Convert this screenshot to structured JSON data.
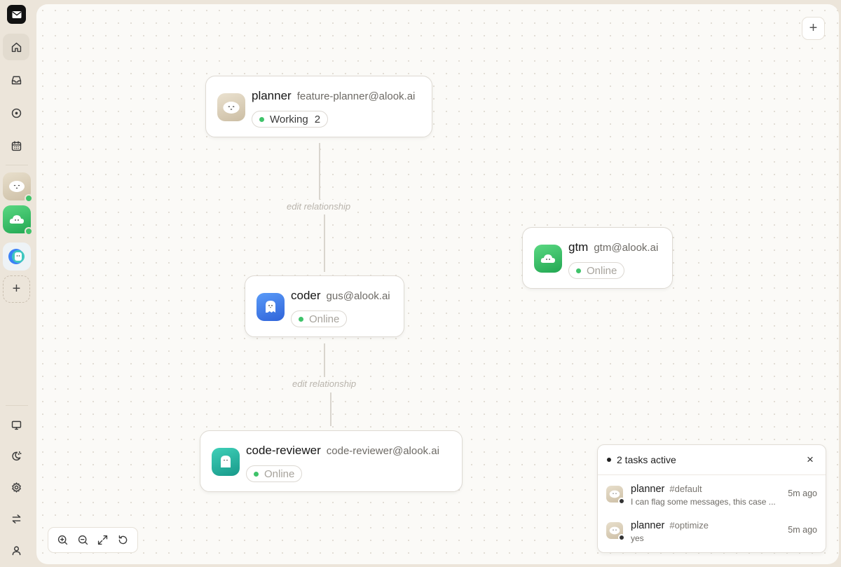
{
  "sidebar": {
    "nav": [
      {
        "name": "home-icon",
        "active": true
      },
      {
        "name": "inbox-icon",
        "active": false
      },
      {
        "name": "circle-dot-icon",
        "active": false
      },
      {
        "name": "calendar-icon",
        "active": false
      }
    ],
    "agents": [
      {
        "name": "planner",
        "icon": "face-icon",
        "color": "#ddd2bd",
        "online": true
      },
      {
        "name": "gtm",
        "icon": "cloud-icon",
        "color": "#3bc46a",
        "online": true
      },
      {
        "name": "coder",
        "icon": "ghost-icon",
        "color": "#dbeefc",
        "online": false
      }
    ],
    "add_agent": "+",
    "bottom": [
      {
        "name": "monitor-icon"
      },
      {
        "name": "theme-icon"
      },
      {
        "name": "gear-icon"
      },
      {
        "name": "swap-icon"
      },
      {
        "name": "user-icon"
      }
    ]
  },
  "canvas": {
    "add_button": "+",
    "edges": [
      {
        "label": "edit relationship"
      },
      {
        "label": "edit relationship"
      }
    ],
    "nodes": {
      "planner": {
        "name": "planner",
        "email": "feature-planner@alook.ai",
        "status": "Working",
        "count": "2",
        "color": "#ddd3bf"
      },
      "gtm": {
        "name": "gtm",
        "email": "gtm@alook.ai",
        "status": "Online",
        "color": "#36c165"
      },
      "coder": {
        "name": "coder",
        "email": "gus@alook.ai",
        "status": "Online",
        "color": "#3b7ff0"
      },
      "reviewer": {
        "name": "code-reviewer",
        "email": "code-reviewer@alook.ai",
        "status": "Online",
        "color": "#22b3a0"
      }
    }
  },
  "zoom_controls": [
    "zoom-in-icon",
    "zoom-out-icon",
    "fit-view-icon",
    "reset-icon"
  ],
  "tasks": {
    "title": "2 tasks active",
    "close": "×",
    "items": [
      {
        "agent": "planner",
        "channel": "#default",
        "message": "I can flag some messages, this case ...",
        "time": "5m ago"
      },
      {
        "agent": "planner",
        "channel": "#optimize",
        "message": "yes",
        "time": "5m ago"
      }
    ]
  }
}
